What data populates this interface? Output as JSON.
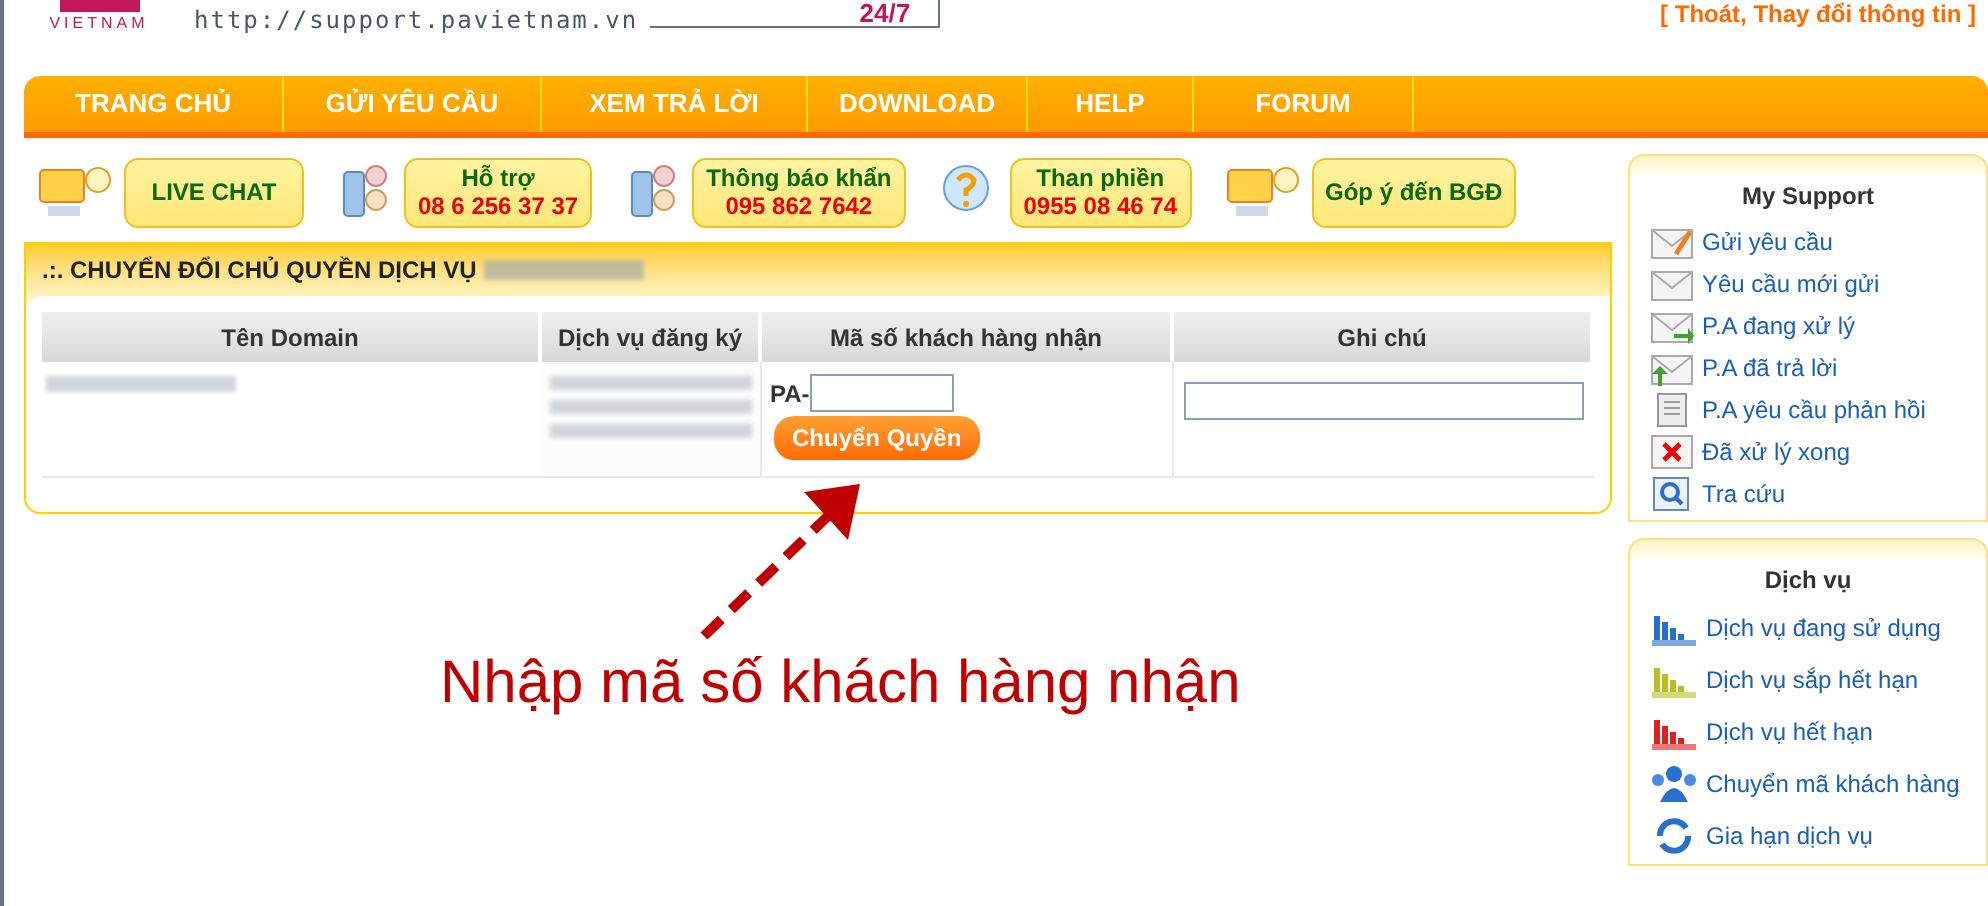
{
  "header": {
    "logo_text": "VIETNAM",
    "url": "http://support.pavietnam.vn",
    "badge": "24/7",
    "account_links": "[ Thoát, Thay đổi thông tin ]"
  },
  "nav": [
    {
      "label": "TRANG CHỦ"
    },
    {
      "label": "GỬI YÊU CẦU"
    },
    {
      "label": "XEM TRẢ LỜI"
    },
    {
      "label": "DOWNLOAD"
    },
    {
      "label": "HELP"
    },
    {
      "label": "FORUM"
    }
  ],
  "contacts": [
    {
      "kind": "chat",
      "title": "LIVE CHAT"
    },
    {
      "kind": "phone",
      "title": "Hỗ trợ",
      "phone": "08 6 256 37 37"
    },
    {
      "kind": "phone",
      "title": "Thông báo khẩn",
      "phone": "095 862 7642"
    },
    {
      "kind": "question",
      "title": "Than phiền",
      "phone": "0955 08 46 74"
    },
    {
      "kind": "chat",
      "title": "Góp ý đến BGĐ"
    }
  ],
  "panel": {
    "title": ".:. CHUYỂN ĐỔI CHỦ QUYỀN DỊCH VỤ",
    "table": {
      "columns": [
        "Tên Domain",
        "Dịch vụ đăng ký",
        "Mã số khách hàng nhận",
        "Ghi chú"
      ],
      "row": {
        "code_prefix": "PA-",
        "button": "Chuyển Quyền"
      }
    }
  },
  "annotation": "Nhập mã số khách hàng nhận",
  "sidebar": [
    {
      "title": "My Support",
      "items": [
        {
          "kind": "pencil",
          "label": "Gửi yêu cầu"
        },
        {
          "kind": "mail",
          "label": "Yêu cầu mới gửi"
        },
        {
          "kind": "mail-out",
          "label": "P.A đang xử lý"
        },
        {
          "kind": "mail-in",
          "label": "P.A đã trả lời"
        },
        {
          "kind": "doc",
          "label": "P.A yêu cầu phản hồi"
        },
        {
          "kind": "done",
          "label": "Đã xử lý xong"
        },
        {
          "kind": "search",
          "label": "Tra cứu"
        }
      ]
    },
    {
      "title": "Dịch vụ",
      "items": [
        {
          "kind": "chart",
          "color": "#2a6fd0",
          "label": "Dịch vụ đang sử dụng"
        },
        {
          "kind": "chart",
          "color": "#b8c020",
          "label": "Dịch vụ sắp hết hạn"
        },
        {
          "kind": "chart",
          "color": "#e02020",
          "label": "Dịch vụ hết hạn"
        },
        {
          "kind": "people",
          "label": "Chuyển mã khách hàng"
        },
        {
          "kind": "refresh",
          "label": "Gia hạn dịch vụ"
        }
      ]
    }
  ]
}
